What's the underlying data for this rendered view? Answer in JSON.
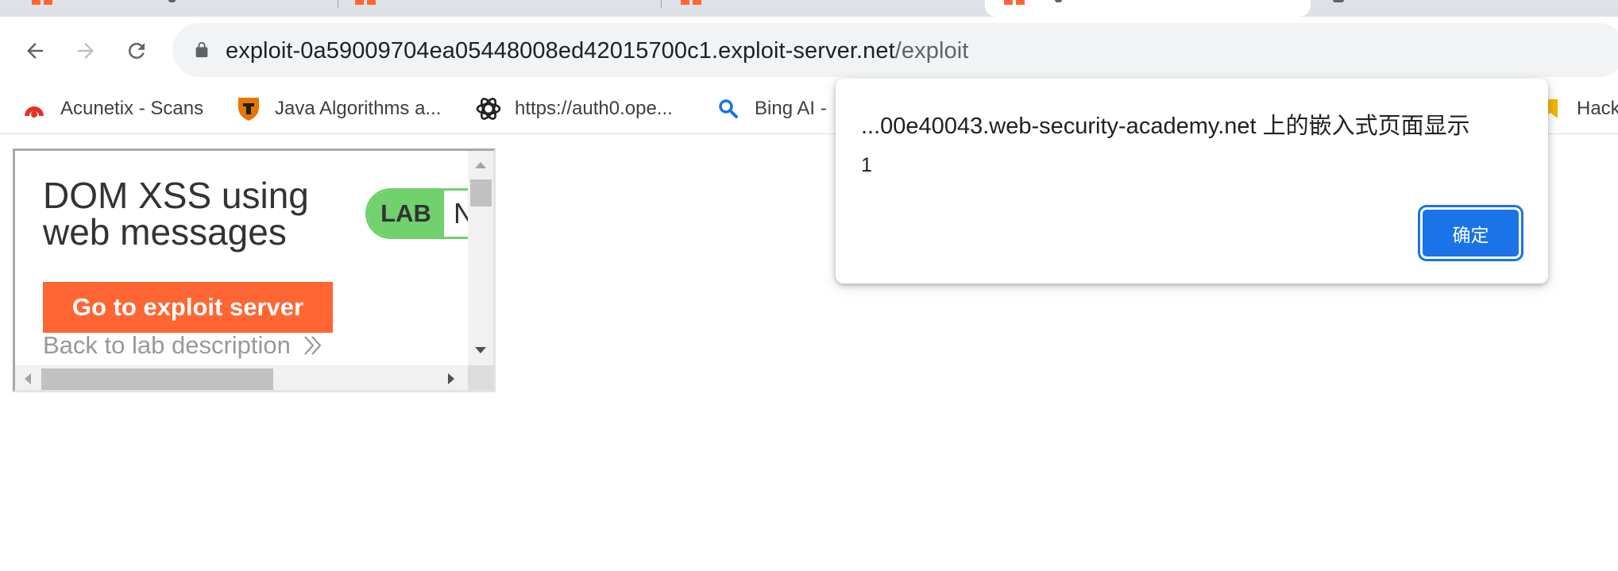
{
  "browser": {
    "tabs": [
      {
        "state": "inactive",
        "favicon": "burp-academy-icon"
      },
      {
        "state": "inactive",
        "favicon": "burp-academy-icon"
      },
      {
        "state": "inactive",
        "favicon": "burp-academy-icon"
      },
      {
        "state": "active",
        "favicon": "burp-academy-icon"
      },
      {
        "state": "inactive",
        "favicon": "generic-page-icon"
      }
    ],
    "nav": {
      "back_icon": "arrow-left-icon",
      "forward_icon": "arrow-right-icon",
      "reload_icon": "reload-icon"
    },
    "address_bar": {
      "lock_icon": "lock-icon",
      "host": "exploit-0a59009704ea05448008ed42015700c1.exploit-server.net",
      "path": "/exploit"
    },
    "bookmarks": [
      {
        "label": "Acunetix - Scans",
        "icon": "acunetix-icon",
        "color": "#e4312b"
      },
      {
        "label": "Java Algorithms a...",
        "icon": "princeton-shield-icon",
        "color": "#e77500"
      },
      {
        "label": "https://auth0.ope...",
        "icon": "openai-icon",
        "color": "#202124"
      },
      {
        "label": "Bing AI -",
        "icon": "search-icon",
        "color": "#1a73e8"
      },
      {
        "label": "Hack",
        "icon": "bookmark-icon",
        "color": "#f4b400"
      }
    ]
  },
  "embedded_page": {
    "title_line1": "DOM XSS using",
    "title_line2": "web messages",
    "lab_badge": "LAB",
    "lab_status": "N",
    "exploit_button": "Go to exploit server",
    "back_link": "Back to lab description",
    "accent_color": "#ff6633",
    "badge_color": "#70d16d"
  },
  "alert_dialog": {
    "title": "...00e40043.web-security-academy.net 上的嵌入式页面显示",
    "message": "1",
    "ok_button": "确定",
    "button_color": "#1a73e8"
  }
}
